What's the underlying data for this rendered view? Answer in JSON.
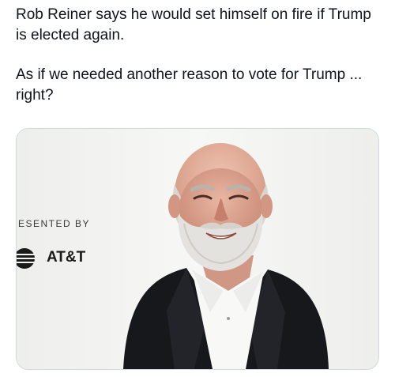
{
  "tweet": {
    "line_one": "Rob Reiner says he would set himself on fire if Trump is elected again.",
    "line_two": "As if we needed another reason to vote for Trump ... right?"
  },
  "media": {
    "backdrop_sponsor_text": "ESENTED BY",
    "backdrop_brand_text": "AT&T"
  },
  "colors": {
    "text": "#0f1419",
    "border": "#cfd9de",
    "backdrop": "#f3f3f1"
  }
}
